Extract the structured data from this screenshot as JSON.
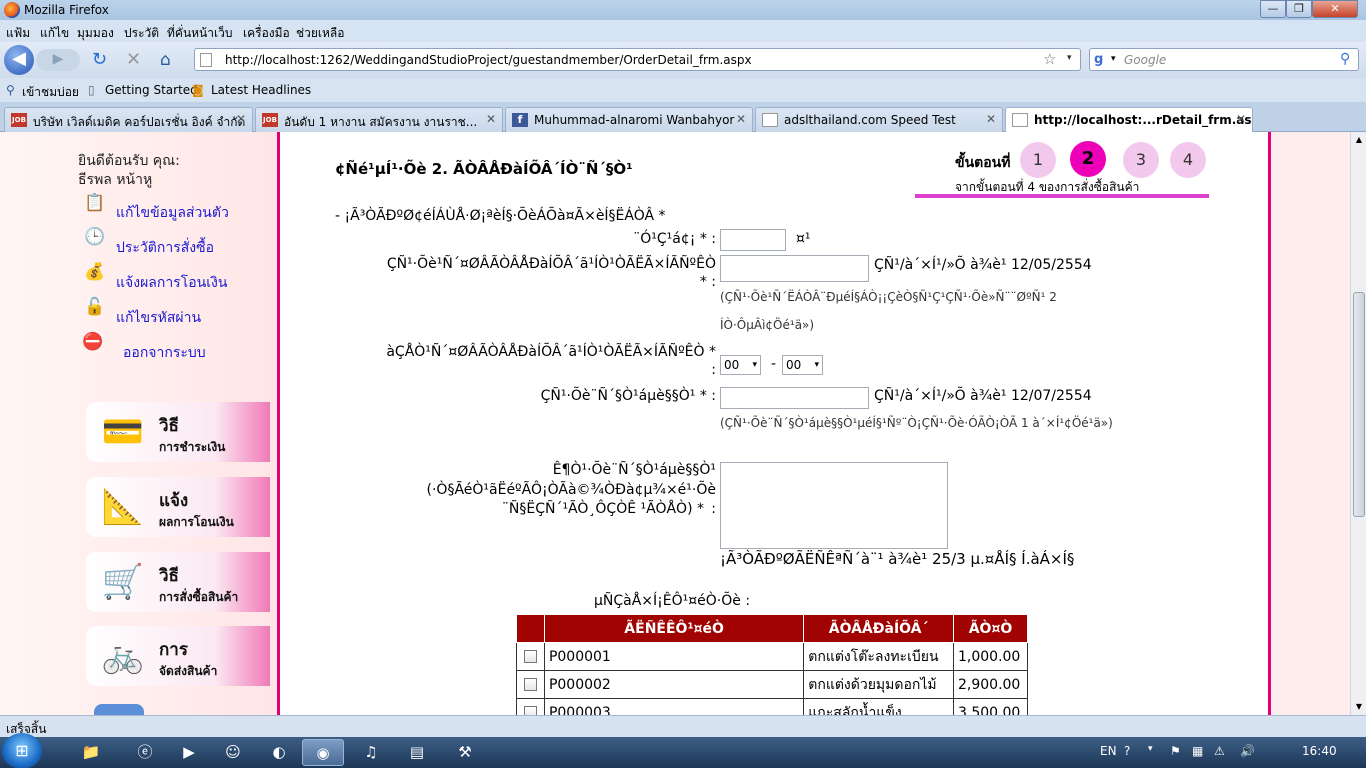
{
  "window": {
    "title": "Mozilla Firefox",
    "min": "—",
    "max": "❐",
    "close": "✕"
  },
  "menu": [
    "แฟ้ม",
    "แก้ไข",
    "มุมมอง",
    "ประวัติ",
    "ที่คั่นหน้าเว็บ",
    "เครื่องมือ",
    "ช่วยเหลือ"
  ],
  "nav": {
    "url": "http://localhost:1262/WeddingandStudioProject/guestandmember/OrderDetail_frm.aspx",
    "search_placeholder": "Google",
    "back": "◀",
    "forward": "▶",
    "reload": "↻",
    "stop": "✕",
    "home": "⌂",
    "star": "☆",
    "dropdown": "▾",
    "search_icon": "⚲"
  },
  "bookmarks": [
    "เข้าชมบ่อย",
    "Getting Started",
    "Latest Headlines"
  ],
  "tabs": [
    {
      "label": "บริษัท เวิลด์เมดิค คอร์ปอเรชั่น อิงค์ จำกัด",
      "icon": "JOB",
      "close": "✕"
    },
    {
      "label": "อันดับ 1 หางาน สมัครงาน งานราช...",
      "icon": "JOB",
      "close": "✕"
    },
    {
      "label": "Muhummad-alnaromi Wanbahyor",
      "icon": "f",
      "close": "✕"
    },
    {
      "label": "adslthailand.com Speed Test",
      "icon": "",
      "close": "✕"
    },
    {
      "label": "http://localhost:...rDetail_frm.aspx",
      "icon": "",
      "close": "✕"
    }
  ],
  "newtab": "+",
  "sidebar": {
    "welcome": "ยินดีต้อนรับ คุณ:",
    "user": "ธีรพล หน้าหู",
    "links": [
      {
        "label": "แก้ไขข้อมูลส่วนตัว",
        "icon": "📋"
      },
      {
        "label": "ประวัติการสั่งซื้อ",
        "icon": "🕒"
      },
      {
        "label": "แจ้งผลการโอนเงิน",
        "icon": "💰"
      },
      {
        "label": "แก้ไขรหัสผ่าน",
        "icon": "🔓"
      },
      {
        "label": "ออกจากระบบ",
        "icon": "⛔"
      }
    ],
    "buttons": [
      {
        "big": "วิธี",
        "small": "การชำระเงิน",
        "icon": "💳"
      },
      {
        "big": "แจ้ง",
        "small": "ผลการโอนเงิน",
        "icon": "📐"
      },
      {
        "big": "วิธี",
        "small": "การสั่งซื้อสินค้า",
        "icon": "🛒"
      },
      {
        "big": "การ",
        "small": "จัดส่งสินค้า",
        "icon": "🚲"
      }
    ]
  },
  "main": {
    "heading": "¢Ñé¹µÍ¹·Õè 2. ÃÒÂÅÐàÍÕÂ´ÍÒ¨Ñ´§Ò¹",
    "steps": {
      "label": "ขั้นตอนที่",
      "items": [
        "1",
        "2",
        "3",
        "4"
      ],
      "current": 2,
      "caption": "จากขั้นตอนที่ 4 ของการสั่งซื้อสินค้า"
    },
    "instruction": "- ¡Ã³ÒÃÐºØ¢éÍÁÙÅ·Ø¡ªèÍ§·ÕèÁÕà¤Ã×èÍ§ËÁÒÂ *",
    "f_guests_label": "¨Ó¹Ç¹á¢¡ * :",
    "f_guests_unit": "¤¹",
    "f_start_label1": "ÇÑ¹·Õè¹Ñ´¤ØÂÃÒÂÅÐàÍÕÂ´ã¹ÍÒ¹ÒÃËÃ×ÍÃÑºÊÒ",
    "f_start_label2": "* :",
    "f_start_hint": "ÇÑ¹/à´×Í¹/»Õ à¾è¹ 12/05/2554",
    "f_start_note1": "(ÇÑ¹·Õè¹Ñ´ËÁÒÂ¨ÐµéÍ§ÁÒ¡¡ÇèÒ§Ñ¹Ç¹ÇÑ¹·Õè»Ñ¨¨ØºÑ¹  2",
    "f_start_note2": "ÍÒ·ÔµÂì¢Öé¹ä»)",
    "f_time_label1": "àÇÅÒ¹Ñ´¤ØÂÃÒÂÅÐàÍÕÂ´ã¹ÍÒ¹ÒÃËÃ×ÍÃÑºÊÒ *",
    "f_time_label2": ":",
    "time_hour": "00",
    "time_sep": "-",
    "time_min": "00",
    "select_arrow": "▾",
    "f_date_label": "ÇÑ¹·Õè¨Ñ´§Ò¹áµè§§Ò¹ * :",
    "f_date_hint": "ÇÑ¹/à´×Í¹/»Õ à¾è¹ 12/07/2554",
    "f_date_note": "(ÇÑ¹·Õè¨Ñ´§Ò¹áµè§§Ò¹µéÍ§¹Ñº¨Ò¡ÇÑ¹·Õè·ÓÃÒ¡ÒÃ 1 à´×Í¹¢Öé¹ä»)",
    "f_place_label1": "Ê¶Ò¹·Õè¨Ñ´§Ò¹áµè§§Ò¹",
    "f_place_label2": "(·Ò§ÃéÒ¹ãËéºÃÔ¡ÒÃà©¾ÒÐà¢µ¾×é¹·Õè",
    "f_place_label3": "¨Ñ§ËÇÑ´¹ÃÒ¸ÔÇÒÊ ¹ÃÒÅÒ) *",
    "f_place_colon": ":",
    "f_place_hint": "¡Ã³ÒÃÐºØÃËÑÊªÑ´à¨¹ à¾è¹ 25/3 µ.¤ÅÍ§ Í.àÁ×Í§",
    "table_caption": "µÑÇàÅ×Í¡ÊÔ¹¤éÒ·Õè :"
  },
  "table": {
    "headers": [
      "",
      "ÃËÑÊÊÔ¹¤éÒ",
      "ÃÒÂÅÐàÍÕÂ´",
      "ÃÒ¤Ò"
    ],
    "rows": [
      {
        "code": "P000001",
        "desc": "ตกแต่งโต๊ะลงทะเบียน",
        "price": "1,000.00"
      },
      {
        "code": "P000002",
        "desc": "ตกแต่งด้วยมุมดอกไม้",
        "price": "2,900.00"
      },
      {
        "code": "P000003",
        "desc": "แกะสลักน้ำแข็ง",
        "price": "3,500.00"
      }
    ]
  },
  "status": "เสร็จสิ้น",
  "tray": {
    "lang": "EN",
    "time": "16:40"
  },
  "colors": {
    "accent": "#e0007a",
    "table_header": "#a10303",
    "step_current": "#ee00b8",
    "step": "#f2c8ec",
    "link": "#1a1ad0"
  }
}
